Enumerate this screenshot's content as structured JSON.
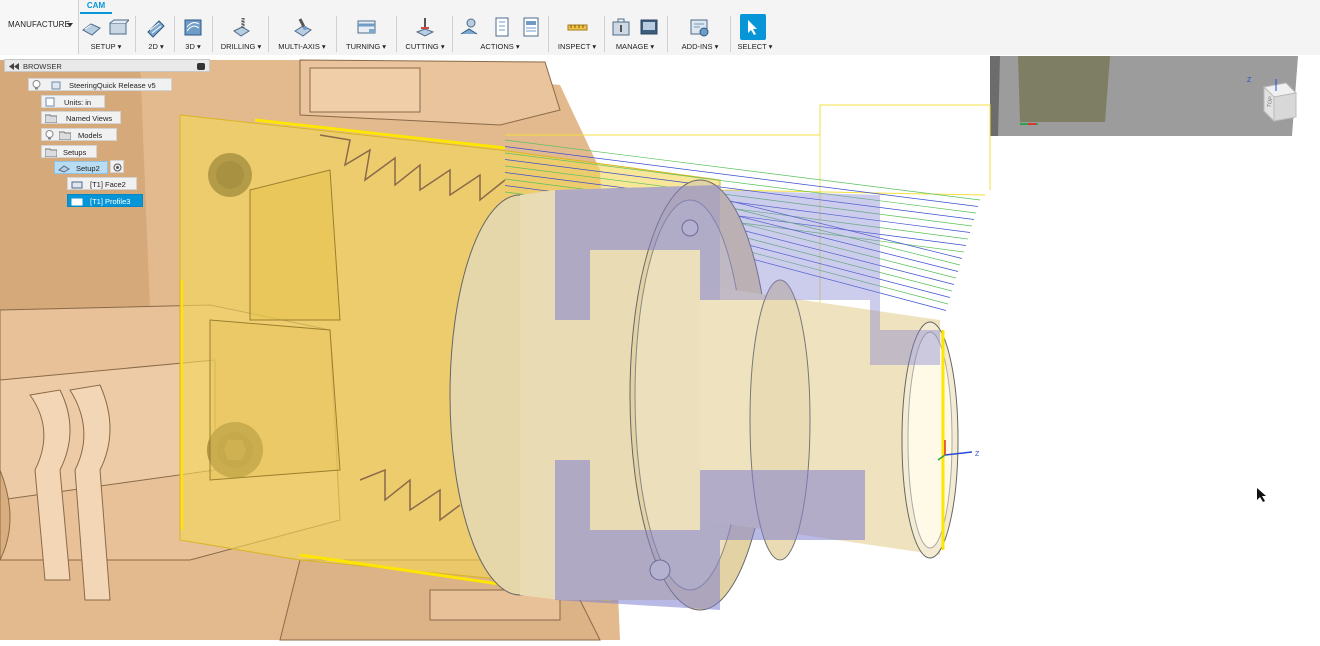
{
  "workspace": {
    "label": "MANUFACTURE"
  },
  "tab": {
    "label": "CAM"
  },
  "toolbar": {
    "groups": [
      {
        "label": "SETUP ▾"
      },
      {
        "label": "2D ▾"
      },
      {
        "label": "3D ▾"
      },
      {
        "label": "DRILLING ▾"
      },
      {
        "label": "MULTI-AXIS ▾"
      },
      {
        "label": "TURNING ▾"
      },
      {
        "label": "CUTTING ▾"
      },
      {
        "label": "ACTIONS ▾"
      },
      {
        "label": "INSPECT ▾"
      },
      {
        "label": "MANAGE ▾"
      },
      {
        "label": "ADD-INS ▾"
      },
      {
        "label": "SELECT ▾"
      }
    ]
  },
  "browser": {
    "title": "BROWSER",
    "document": "SteeringQuick  Release v5",
    "units": "Units: in",
    "named_views": "Named Views",
    "models": "Models",
    "setups": "Setups",
    "setup2": "Setup2",
    "op1": "[T1] Face2",
    "op2": "[T1] Profile3"
  },
  "viewcube": {
    "face": "TOP",
    "axis": "Z"
  },
  "triad": {
    "axis": "Z"
  },
  "colors": {
    "accent": "#0696d7",
    "stock": "#f2d35a",
    "chuck": "#e0b88f",
    "part": "#e9dcb4",
    "section": "#8f8fce"
  }
}
